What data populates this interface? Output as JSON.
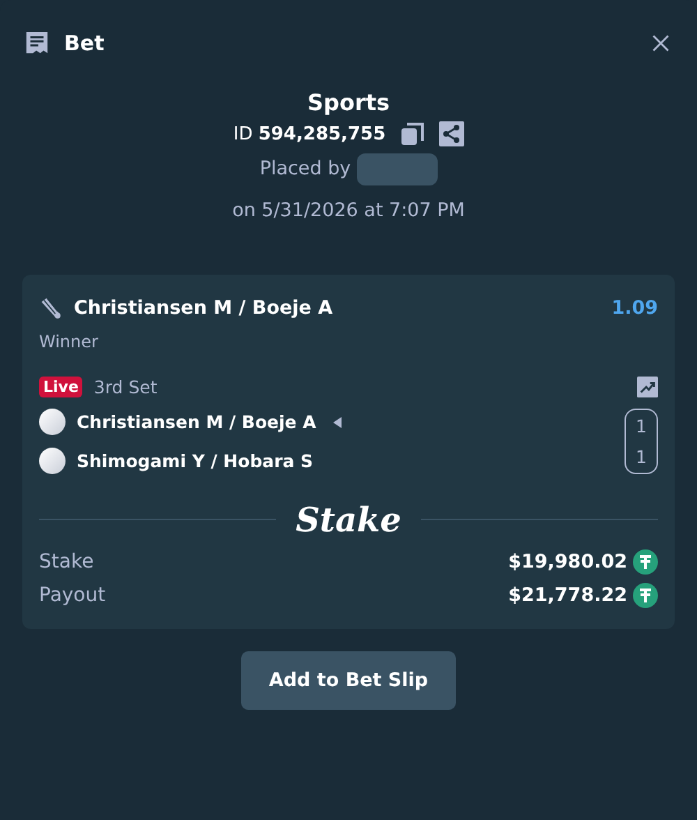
{
  "header": {
    "title": "Bet"
  },
  "summary": {
    "category": "Sports",
    "id_label": "ID",
    "id_value": "594,285,755",
    "placed_by": "Placed by",
    "placed_on": "on 5/31/2026 at 7:07 PM"
  },
  "selection": {
    "event": "Christiansen M / Boeje A",
    "odds": "1.09",
    "market": "Winner",
    "live": true,
    "live_label": "Live",
    "period": "3rd Set",
    "teams": [
      {
        "name": "Christiansen M / Boeje A",
        "serving": true,
        "score": "1"
      },
      {
        "name": "Shimogami Y / Hobara S",
        "serving": false,
        "score": "1"
      }
    ]
  },
  "logo": "Stake",
  "totals": [
    {
      "label": "Stake",
      "amount": "$19,980.02"
    },
    {
      "label": "Payout",
      "amount": "$21,778.22"
    }
  ],
  "action": "Add to Bet Slip"
}
